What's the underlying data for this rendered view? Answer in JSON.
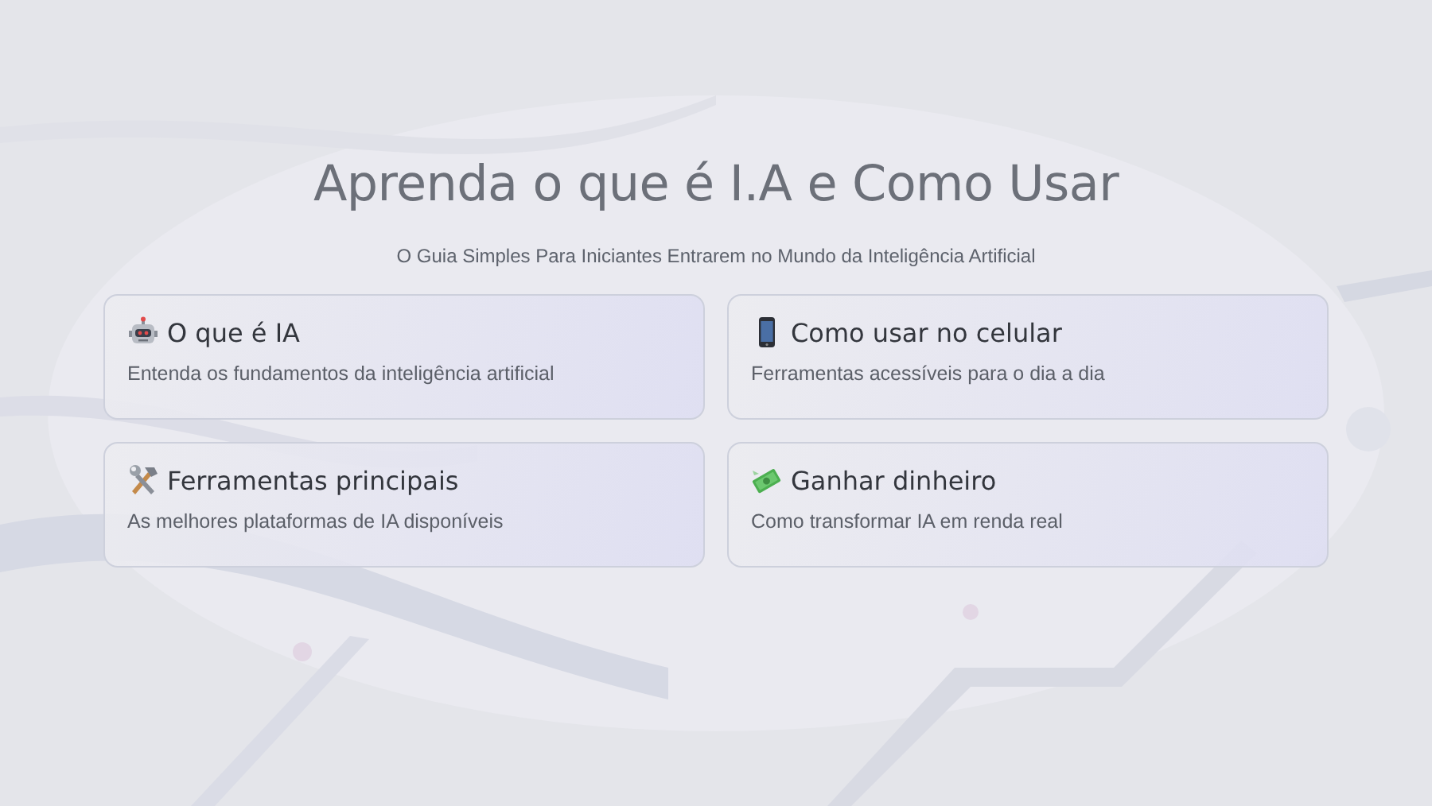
{
  "hero": {
    "title": "Aprenda o que é I.A e Como Usar",
    "subtitle": "O Guia Simples Para Iniciantes Entrarem no Mundo da Inteligência Artificial"
  },
  "cards": [
    {
      "title": "O que é IA",
      "description": "Entenda os fundamentos da inteligência artificial"
    },
    {
      "title": "Como usar no celular",
      "description": "Ferramentas acessíveis para o dia a dia"
    },
    {
      "title": "Ferramentas principais",
      "description": "As melhores plataformas de IA disponíveis"
    },
    {
      "title": "Ganhar dinheiro",
      "description": "Como transformar IA em renda real"
    }
  ]
}
